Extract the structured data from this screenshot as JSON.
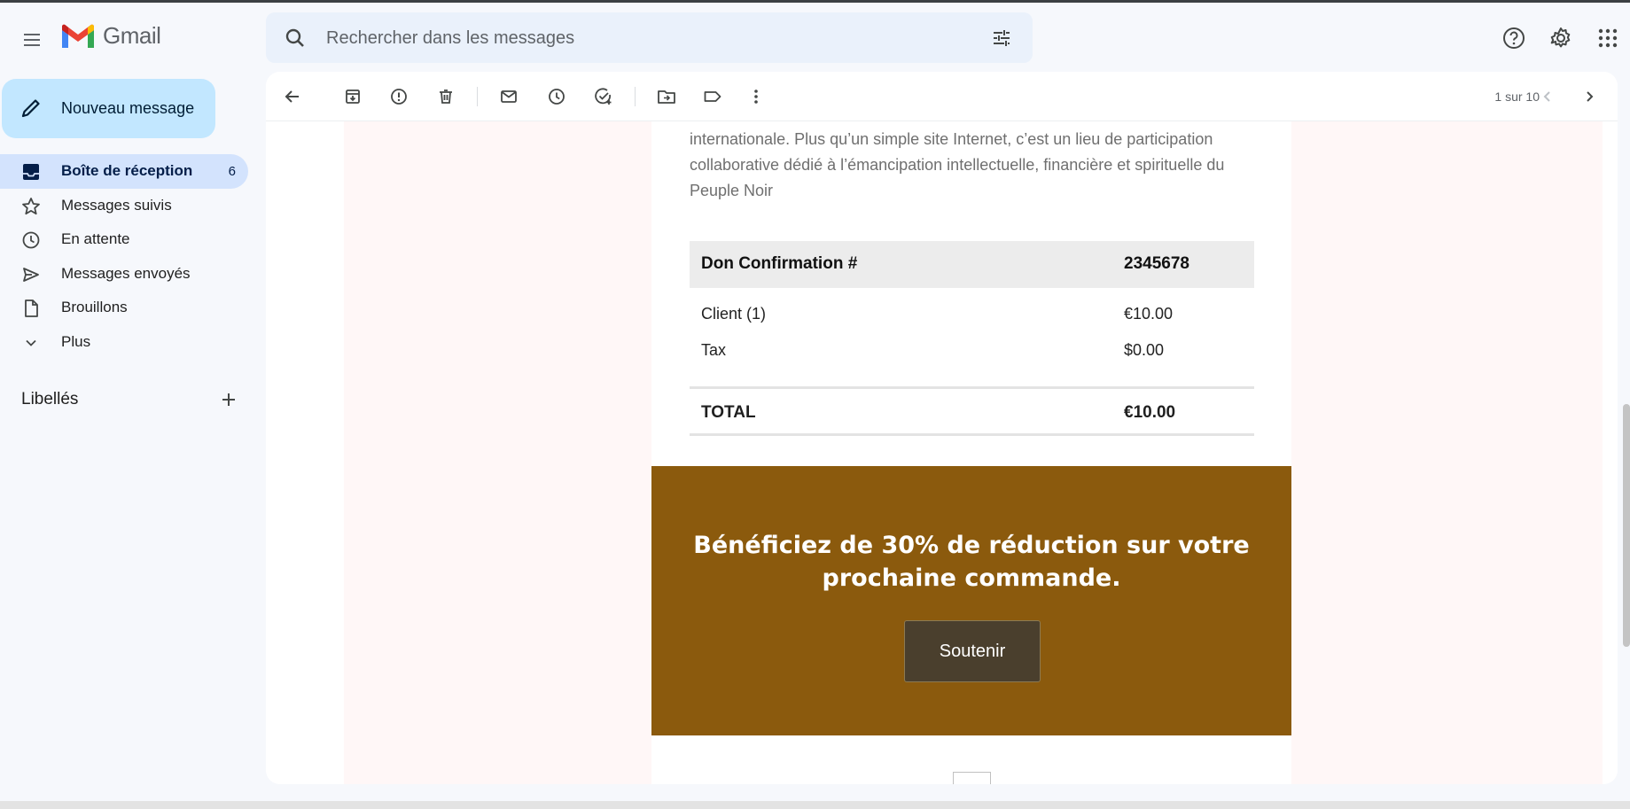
{
  "app": {
    "name": "Gmail"
  },
  "search": {
    "placeholder": "Rechercher dans les messages"
  },
  "sidebar": {
    "compose_label": "Nouveau message",
    "items": [
      {
        "label": "Boîte de réception",
        "count": "6",
        "icon": "inbox-icon",
        "active": true
      },
      {
        "label": "Messages suivis",
        "count": "",
        "icon": "star-icon"
      },
      {
        "label": "En attente",
        "count": "",
        "icon": "clock-icon"
      },
      {
        "label": "Messages envoyés",
        "count": "",
        "icon": "send-icon"
      },
      {
        "label": "Brouillons",
        "count": "",
        "icon": "draft-icon"
      },
      {
        "label": "Plus",
        "count": "",
        "icon": "chevron-down-icon"
      }
    ],
    "labels_header": "Libellés"
  },
  "toolbar": {
    "pager": "1 sur 10"
  },
  "email": {
    "intro": "internationale. Plus qu’un simple site Internet, c’est un lieu de participation collaborative dédié à l’émancipation intellectuelle, financière et spirituelle du Peuple Noir",
    "table": {
      "header": {
        "label": "Don Confirmation #",
        "value": "2345678"
      },
      "rows": [
        {
          "label": "Client (1)",
          "value": "€10.00"
        },
        {
          "label": "Tax",
          "value": "$0.00"
        }
      ],
      "total": {
        "label": "TOTAL",
        "value": "€10.00"
      }
    },
    "promo": {
      "title": "Bénéficiez de 30% de réduction sur votre prochaine commande.",
      "button": "Soutenir",
      "bg_color": "#8b5a0d"
    }
  },
  "colors": {
    "compose_bg": "#c2e7ff",
    "active_nav_bg": "#d3e3fd",
    "search_bg": "#eaf1fb"
  }
}
